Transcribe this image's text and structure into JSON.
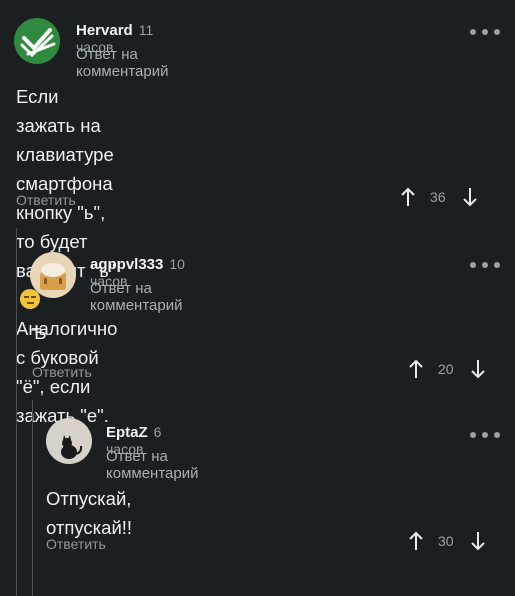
{
  "comments": [
    {
      "author": "Hervard",
      "time": "11 часов",
      "subtitle": "Ответ на комментарий",
      "lines": [
        "Если зажать на клавиатуре смартфона кнопку \"ь\",",
        "то будет вариант \"ъ\"",
        "Аналогично с буковой \"ё\", если зажать \"е\"."
      ],
      "emoji": "smirk-emoji",
      "reply_label": "Ответить",
      "votes": "36"
    },
    {
      "author": "agppvl333",
      "time": "10 часов",
      "subtitle": "Ответ на комментарий",
      "text": "Ѣ",
      "reply_label": "Ответить",
      "votes": "20"
    },
    {
      "author": "EptaZ",
      "time": "6 часов",
      "subtitle": "Ответ на комментарий",
      "text": "Отпускай, отпускай!!",
      "reply_label": "Ответить",
      "votes": "30"
    }
  ],
  "colors": {
    "background": "#1b1f22",
    "avatar1_bg": "#2f8a3f",
    "muted": "#9aa3a9"
  },
  "icons": [
    "more-options-icon",
    "upvote-arrow-icon",
    "downvote-arrow-icon"
  ]
}
